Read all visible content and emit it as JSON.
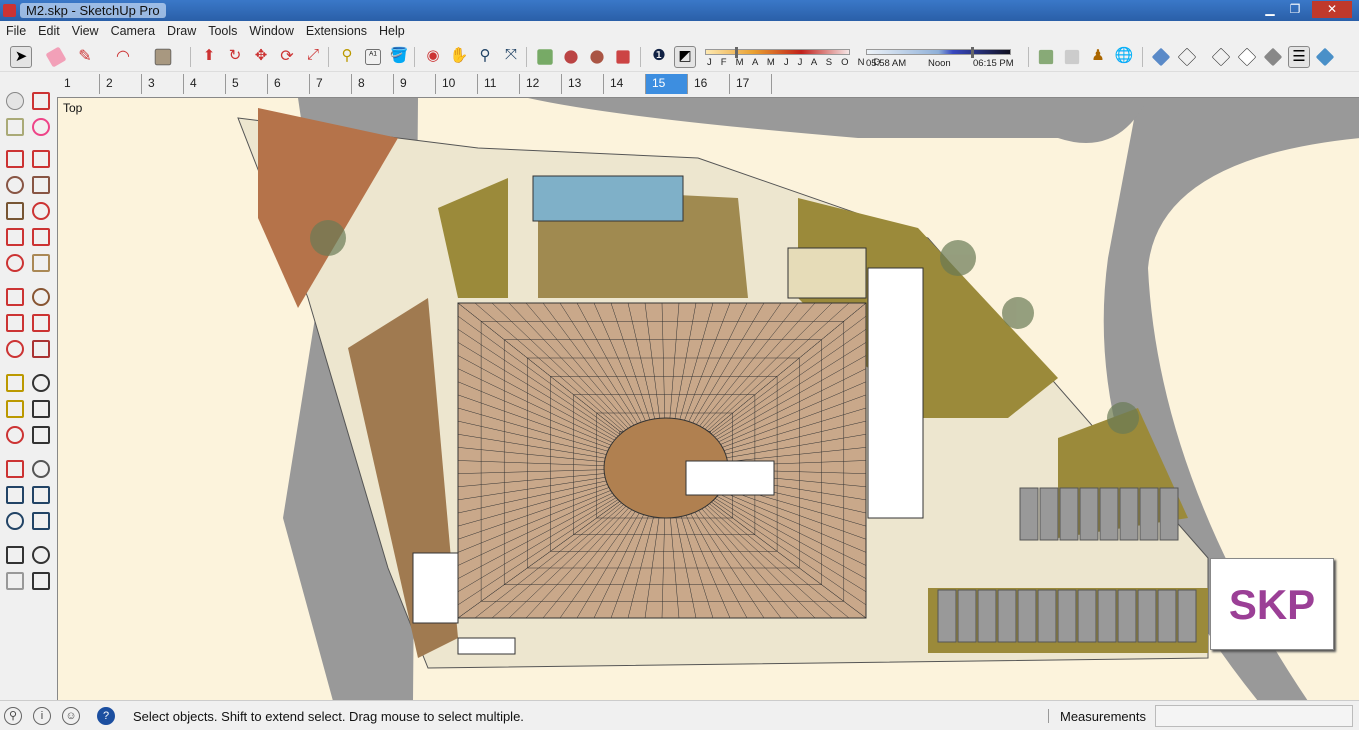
{
  "window": {
    "title": "M2.skp - SketchUp Pro",
    "controls": [
      "minimize",
      "restore",
      "close"
    ]
  },
  "menu": [
    "File",
    "Edit",
    "View",
    "Camera",
    "Draw",
    "Tools",
    "Window",
    "Extensions",
    "Help"
  ],
  "shadow_settings": {
    "months": "J F M A M J J A S O N D",
    "time_start": "05:58 AM",
    "time_mid": "Noon",
    "time_end": "06:15 PM",
    "date_month_fraction": 0.2,
    "time_fraction": 0.72
  },
  "scenes": {
    "tabs": [
      "1",
      "2",
      "3",
      "4",
      "5",
      "6",
      "7",
      "8",
      "9",
      "10",
      "11",
      "12",
      "13",
      "14",
      "15",
      "16",
      "17"
    ],
    "active": "15"
  },
  "viewport": {
    "view_label": "Top",
    "watermark": "SKP"
  },
  "status": {
    "hint": "Select objects. Shift to extend select. Drag mouse to select multiple.",
    "measurements_label": "Measurements",
    "measurements_value": ""
  },
  "colors": {
    "accent": "#3d8ee0",
    "titlebar": "#2a5fa8",
    "watermark": "#9b3f96"
  }
}
